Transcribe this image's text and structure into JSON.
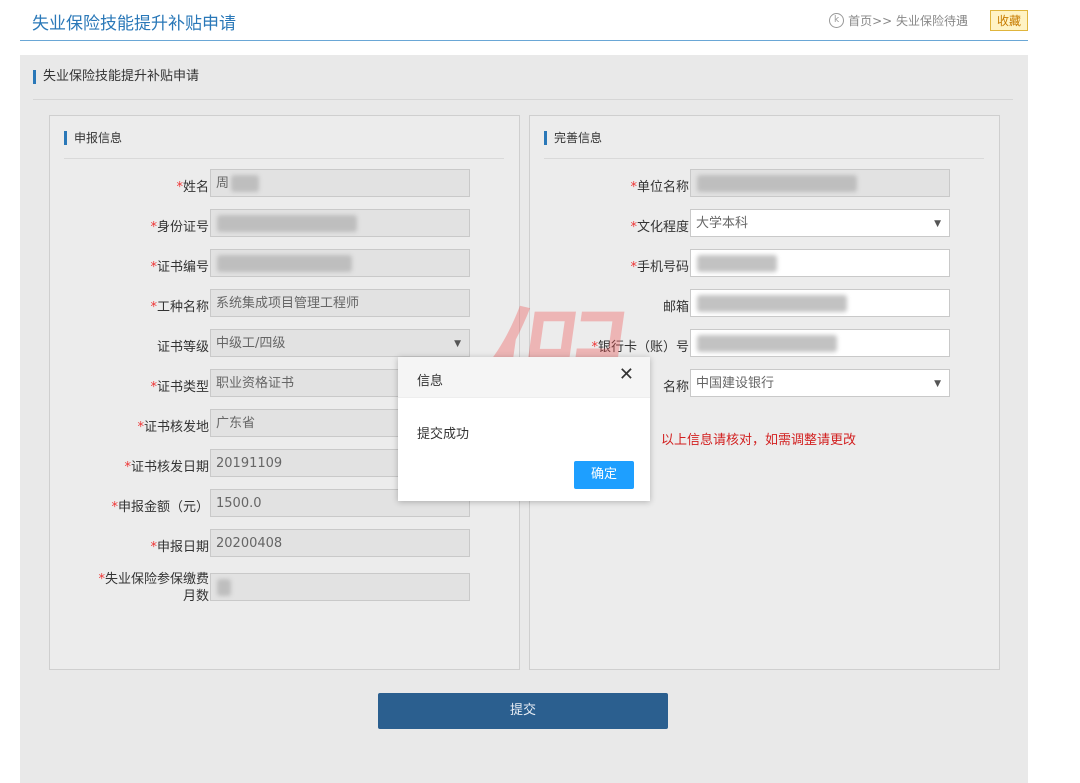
{
  "header": {
    "title": "失业保险技能提升补贴申请",
    "breadcrumb": "首页>> 失业保险待遇",
    "favorite_label": "收藏"
  },
  "section_title": "失业保险技能提升补贴申请",
  "left_panel": {
    "heading": "申报信息",
    "fields": [
      {
        "label": "姓名",
        "required": "*",
        "value": "周"
      },
      {
        "label": "身份证号",
        "required": "*",
        "value": ""
      },
      {
        "label": "证书编号",
        "required": "*",
        "value": ""
      },
      {
        "label": "工种名称",
        "required": "*",
        "value": "系统集成项目管理工程师"
      },
      {
        "label": "证书等级",
        "required": "",
        "value": "中级工/四级"
      },
      {
        "label": "证书类型",
        "required": "*",
        "value": "职业资格证书"
      },
      {
        "label": "证书核发地",
        "required": "*",
        "value": "广东省"
      },
      {
        "label": "证书核发日期",
        "required": "*",
        "value": "20191109"
      },
      {
        "label": "申报金额（元）",
        "required": "*",
        "value": "1500.0"
      },
      {
        "label": "申报日期",
        "required": "*",
        "value": "20200408"
      },
      {
        "label": "失业保险参保缴费",
        "label2": "月数",
        "required": "*",
        "value": ""
      }
    ]
  },
  "right_panel": {
    "heading": "完善信息",
    "fields": [
      {
        "label": "单位名称",
        "required": "*",
        "value": ""
      },
      {
        "label": "文化程度",
        "required": "*",
        "value": "大学本科"
      },
      {
        "label": "手机号码",
        "required": "*",
        "value": ""
      },
      {
        "label": "邮箱",
        "required": "",
        "value": ""
      },
      {
        "label": "银行卡（账）号",
        "required": "*",
        "value": ""
      },
      {
        "label": "名称",
        "required": "",
        "value": "中国建设银行"
      }
    ],
    "note": "以上信息请核对，如需调整请更改"
  },
  "submit_label": "提交",
  "dialog": {
    "title": "信息",
    "message": "提交成功",
    "confirm_label": "确定"
  },
  "watermark_text": "假"
}
